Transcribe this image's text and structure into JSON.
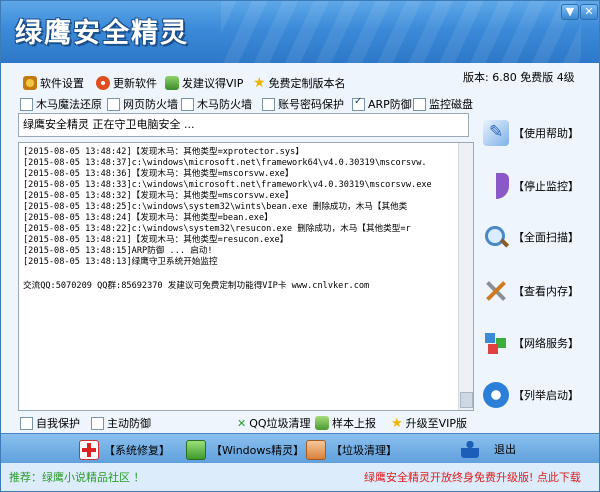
{
  "window": {
    "title": "绿鹰安全精灵",
    "minimize": "▼",
    "close": "✕"
  },
  "toolbar": {
    "settings": "软件设置",
    "update": "更新软件",
    "suggest": "发建议得VIP",
    "custom": "免费定制版本名",
    "version": "版本: 6.80 免费版 4级"
  },
  "checks": [
    {
      "label": "木马魔法还原",
      "checked": false
    },
    {
      "label": "网页防火墙",
      "checked": false
    },
    {
      "label": "木马防火墙",
      "checked": false
    },
    {
      "label": "账号密码保护",
      "checked": false
    },
    {
      "label": "ARP防御",
      "checked": true
    },
    {
      "label": "监控磁盘",
      "checked": false
    }
  ],
  "status_text": "绿鹰安全精灵 正在守卫电脑安全 ...",
  "log": [
    "[2015-08-05 13:48:42]【发现木马：其他类型=xprotector.sys】",
    "[2015-08-05 13:48:37]c:\\windows\\microsoft.net\\framework64\\v4.0.30319\\mscorsvw.",
    "[2015-08-05 13:48:36]【发现木马：其他类型=mscorsvw.exe】",
    "[2015-08-05 13:48:33]c:\\windows\\microsoft.net\\framework\\v4.0.30319\\mscorsvw.exe",
    "[2015-08-05 13:48:32]【发现木马：其他类型=mscorsvw.exe】",
    "[2015-08-05 13:48:25]c:\\windows\\system32\\wints\\bean.exe 删除成功，木马【其他类",
    "[2015-08-05 13:48:24]【发现木马：其他类型=bean.exe】",
    "[2015-08-05 13:48:22]c:\\windows\\system32\\resucon.exe 删除成功，木马【其他类型=r",
    "[2015-08-05 13:48:21]【发现木马：其他类型=resucon.exe】",
    "[2015-08-05 13:48:15]ARP防御 ... 启动!",
    "[2015-08-05 13:48:13]绿鹰守卫系统开始监控"
  ],
  "log_contact": "交流QQ:5070209 QQ群:85692370 发建议可免费定制功能得VIP卡 www.cnlvker.com",
  "side": {
    "help": "【使用帮助】",
    "stop": "【停止监控】",
    "scan": "【全面扫描】",
    "memory": "【查看内存】",
    "network": "【网络服务】",
    "startup": "【列举启动】"
  },
  "options": {
    "self_protect": "自我保护",
    "active_defense": "主动防御",
    "qq_clean": "QQ垃圾清理",
    "report": "样本上报",
    "upgrade": "升级至VIP版"
  },
  "bottom": {
    "repair": "【系统修复】",
    "wizard": "【Windows精灵】",
    "junk": "【垃圾清理】",
    "exit": "退出"
  },
  "footer": {
    "left": "推荐：绿鹰小说精品社区 ！",
    "right": "绿鹰安全精灵开放终身免费升级版! 点此下载"
  },
  "colors": {
    "title_bar": "#3b8ad8",
    "footer_left": "#2b9c2b",
    "footer_right": "#e02020"
  }
}
